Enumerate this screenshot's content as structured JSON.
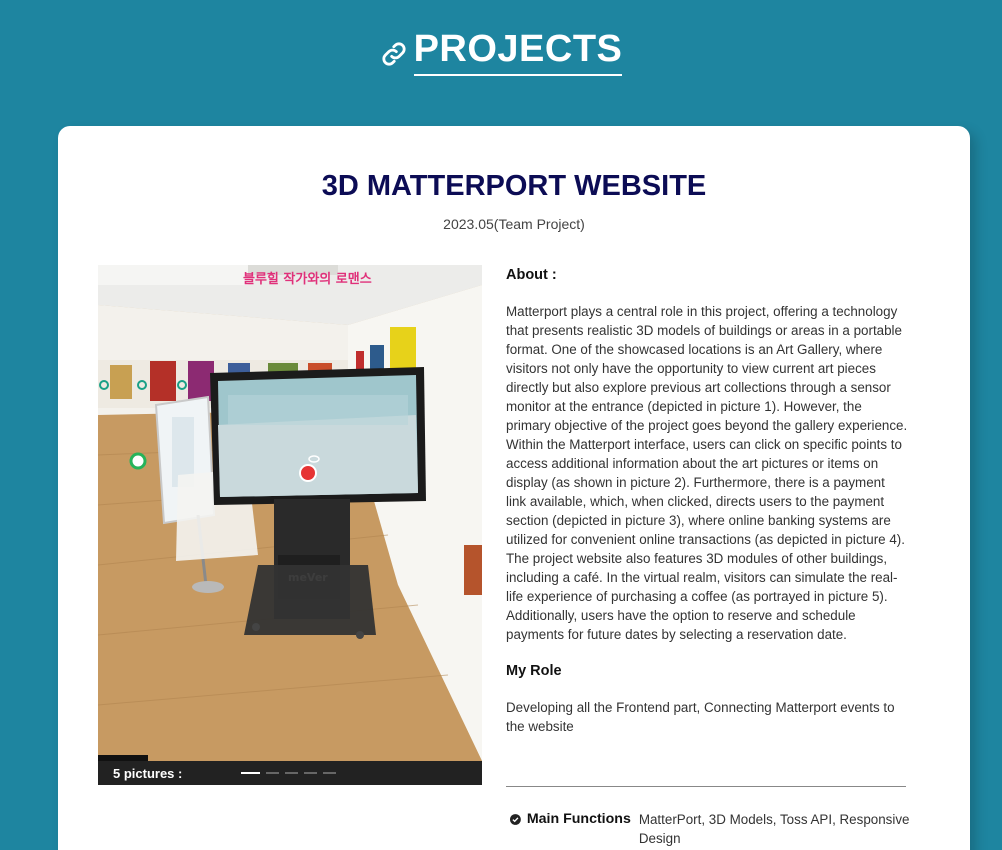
{
  "header": {
    "title": "PROJECTS",
    "icon": "link-icon"
  },
  "project": {
    "title": "3D MATTERPORT WEBSITE",
    "date": "2023.05(Team Project)",
    "gallery": {
      "count_label": "5 pictures :",
      "total_dots": 5,
      "active_index": 0,
      "banner_text": "블루힐 작가와의 로맨스",
      "kiosk_brand": "meVer"
    },
    "about": {
      "heading": "About :",
      "body": "Matterport plays a central role in this project, offering a technology that presents realistic 3D models of buildings or areas in a portable format. One of the showcased locations is an Art Gallery, where visitors not only have the opportunity to view current art pieces directly but also explore previous art collections through a sensor monitor at the entrance (depicted in picture 1). However, the primary objective of the project goes beyond the gallery experience. Within the Matterport interface, users can click on specific points to access additional information about the art pictures or items on display (as shown in picture 2). Furthermore, there is a payment link available, which, when clicked, directs users to the payment section (depicted in picture 3), where online banking systems are utilized for convenient online transactions (as depicted in picture 4). The project website also features 3D modules of other buildings, including a café. In the virtual realm, visitors can simulate the real-life experience of purchasing a coffee (as portrayed in picture 5). Additionally, users have the option to reserve and schedule payments for future dates by selecting a reservation date."
    },
    "role": {
      "heading": "My Role",
      "body": "Developing all the Frontend part, Connecting Matterport events to the website"
    },
    "functions": {
      "label": "Main Functions",
      "value": "MatterPort, 3D Models, Toss API, Responsive Design"
    }
  },
  "colors": {
    "background": "#1e85a0",
    "card": "#ffffff",
    "title": "#0c0c55"
  }
}
